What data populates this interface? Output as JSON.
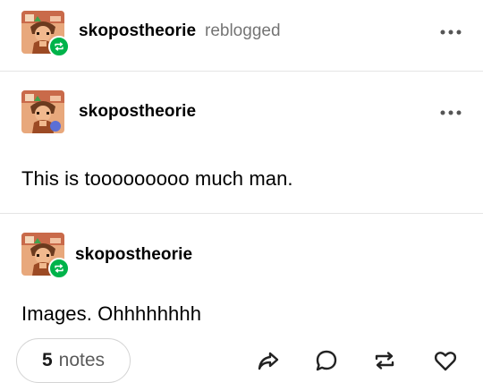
{
  "reblog_header": {
    "blog_name": "skopostheorie",
    "action_text": "reblogged",
    "more_icon": "more-dots-icon"
  },
  "post": {
    "blog_name": "skopostheorie",
    "more_icon": "more-dots-icon",
    "body": "This is tooooooooo much man."
  },
  "reblog": {
    "blog_name": "skopostheorie",
    "body": "Images. Ohhhhhhhh"
  },
  "footer": {
    "notes_count": "5",
    "notes_label": "notes",
    "actions": [
      "share-icon",
      "reply-icon",
      "reblog-icon",
      "like-icon"
    ]
  },
  "colors": {
    "reblog_badge": "#00b34a",
    "divider": "#e5e5e5",
    "secondary_text": "#737373"
  }
}
